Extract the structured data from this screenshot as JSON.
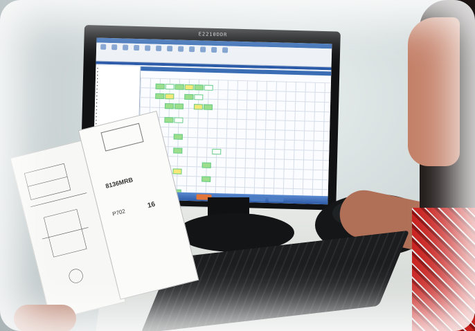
{
  "scene": {
    "description_free": ""
  },
  "monitor": {
    "brand_text": "E2210DDR"
  },
  "document": {
    "logo_text": "",
    "part_code": "8136MRB",
    "field_left": "P702",
    "field_right": "16"
  }
}
